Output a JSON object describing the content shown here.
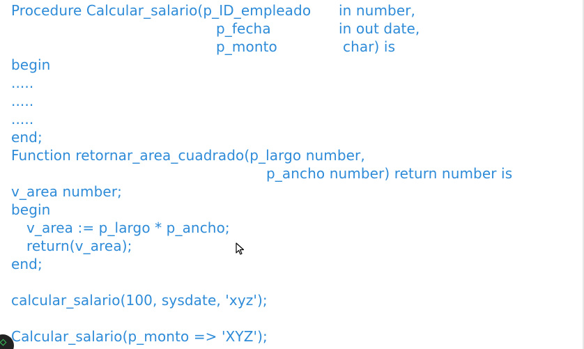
{
  "code": {
    "procedure_header": {
      "line1_left": "Procedure Calcular_salario(p_ID_empleado",
      "line1_right": "in number,",
      "line2_left": "p_fecha",
      "line2_right": "in out date,",
      "line3_left": "p_monto",
      "line3_right": "char) is"
    },
    "procedure_body": {
      "begin": "begin",
      "dots1": ".....",
      "dots2": ".....",
      "dots3": ".....",
      "end": "end;"
    },
    "function_header": {
      "line1": "Function retornar_area_cuadrado(p_largo number,",
      "line2": "p_ancho number) return number is",
      "decl": "v_area number;"
    },
    "function_body": {
      "begin": "begin",
      "assign": "v_area := p_largo * p_ancho;",
      "return_stmt": "return(v_area);",
      "end": "end;"
    },
    "calls": {
      "call1": "calcular_salario(100, sysdate, 'xyz');",
      "call2": "Calcular_salario(p_monto => 'XYZ');"
    }
  },
  "colors": {
    "code_text": "#2e8bd8",
    "background": "#ffffff"
  }
}
